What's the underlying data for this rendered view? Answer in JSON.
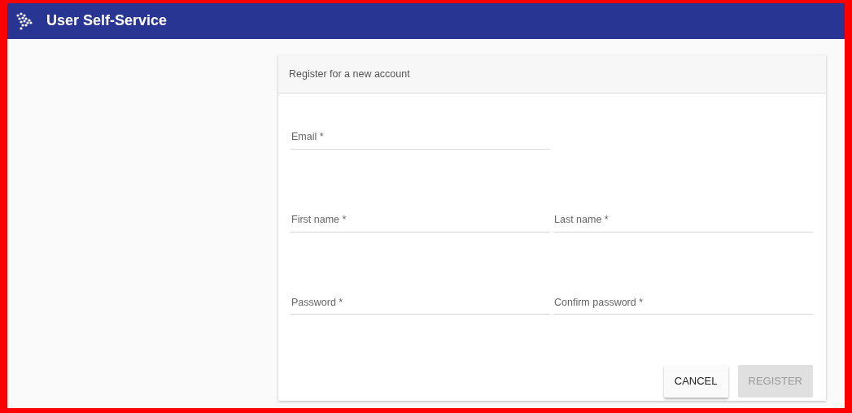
{
  "app_bar": {
    "title": "User Self-Service"
  },
  "form": {
    "title": "Register for a new account",
    "rows": [
      [
        {
          "placeholder": "Email *"
        }
      ],
      [
        {
          "placeholder": "First name *"
        },
        {
          "placeholder": "Last name *"
        }
      ],
      [
        {
          "placeholder": "Password *"
        },
        {
          "placeholder": "Confirm password *"
        }
      ]
    ],
    "buttons": [
      {
        "label": "CANCEL",
        "disabled": false
      },
      {
        "label": "REGISTER",
        "disabled": true
      }
    ]
  }
}
